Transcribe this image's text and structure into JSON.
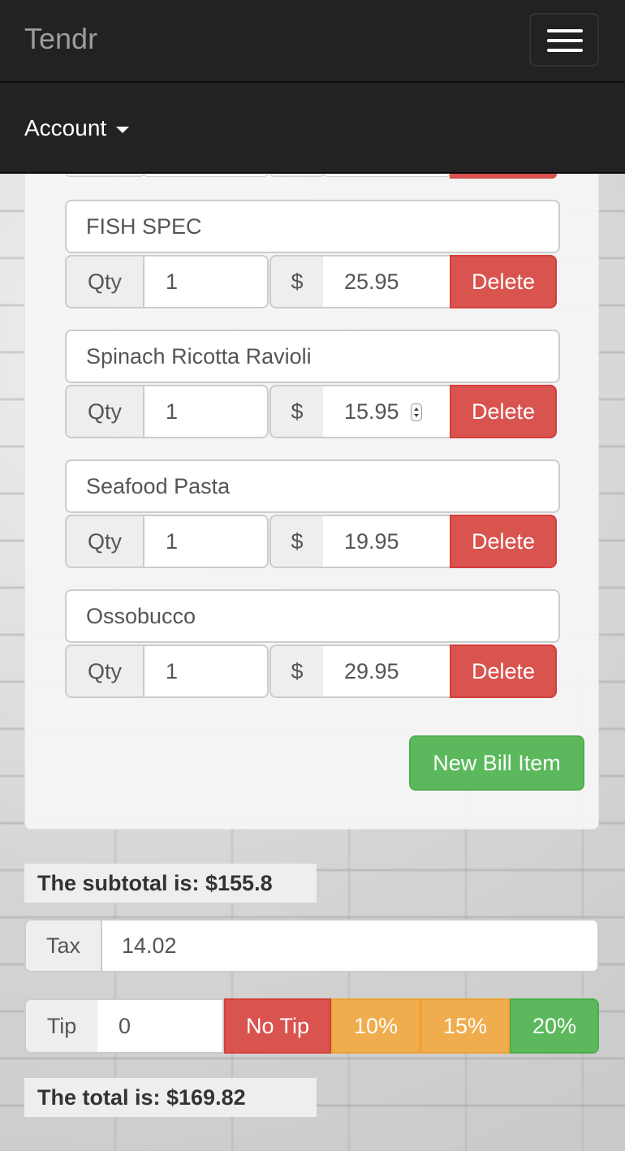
{
  "app": {
    "brand": "Tendr",
    "account_label": "Account"
  },
  "bill_items": [
    {
      "name": "FISH SPEC",
      "qty_label": "Qty",
      "qty": "1",
      "currency": "$",
      "price": "25.95",
      "delete_label": "Delete"
    },
    {
      "name": "Spinach Ricotta Ravioli",
      "qty_label": "Qty",
      "qty": "1",
      "currency": "$",
      "price": "15.95",
      "delete_label": "Delete"
    },
    {
      "name": "Seafood Pasta",
      "qty_label": "Qty",
      "qty": "1",
      "currency": "$",
      "price": "19.95",
      "delete_label": "Delete"
    },
    {
      "name": "Ossobucco",
      "qty_label": "Qty",
      "qty": "1",
      "currency": "$",
      "price": "29.95",
      "delete_label": "Delete"
    }
  ],
  "new_item_label": "New Bill Item",
  "subtotal_text": "The subtotal is: $155.8",
  "tax": {
    "label": "Tax",
    "value": "14.02"
  },
  "tip": {
    "label": "Tip",
    "value": "0",
    "buttons": {
      "none": "No Tip",
      "ten": "10%",
      "fifteen": "15%",
      "twenty": "20%"
    }
  },
  "total_text": "The total is: $169.82",
  "colors": {
    "navbar": "#222222",
    "danger": "#d9534f",
    "warning": "#f0ad4e",
    "success": "#5cb85c"
  }
}
